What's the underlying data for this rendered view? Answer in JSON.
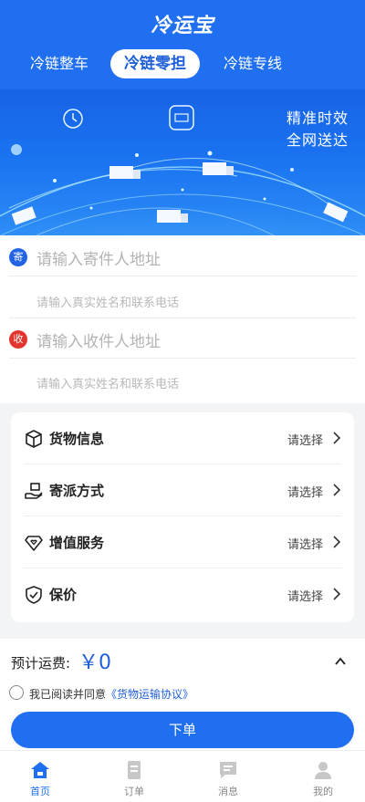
{
  "header": {
    "title": "冷运宝",
    "tabs": [
      {
        "label": "冷链整车",
        "active": false
      },
      {
        "label": "冷链零担",
        "active": true
      },
      {
        "label": "冷链专线",
        "active": false
      }
    ]
  },
  "banner": {
    "slogan_line1": "精准时效",
    "slogan_line2": "全网送达"
  },
  "address": {
    "sender": {
      "badge": "寄",
      "placeholder": "请输入寄件人地址",
      "sub": "请输入真实姓名和联系电话"
    },
    "receiver": {
      "badge": "收",
      "placeholder": "请输入收件人地址",
      "sub": "请输入真实姓名和联系电话"
    }
  },
  "options": [
    {
      "label": "货物信息",
      "value": "请选择",
      "icon": "box-icon"
    },
    {
      "label": "寄派方式",
      "value": "请选择",
      "icon": "hand-delivery-icon"
    },
    {
      "label": "增值服务",
      "value": "请选择",
      "icon": "diamond-heart-icon"
    },
    {
      "label": "保价",
      "value": "请选择",
      "icon": "shield-check-icon"
    }
  ],
  "summary": {
    "fee_label": "预计运费:",
    "fee_value": "￥0",
    "agree_prefix": "我已阅读并同意",
    "agree_link": "《货物运输协议》",
    "submit_label": "下单"
  },
  "tabbar": [
    {
      "label": "首页",
      "icon": "home-icon",
      "active": true
    },
    {
      "label": "订单",
      "icon": "order-icon",
      "active": false
    },
    {
      "label": "消息",
      "icon": "message-icon",
      "active": false
    },
    {
      "label": "我的",
      "icon": "user-icon",
      "active": false
    }
  ],
  "colors": {
    "primary": "#1f6ff0",
    "sender_badge": "#2364e6",
    "receiver_badge": "#e2352e"
  }
}
